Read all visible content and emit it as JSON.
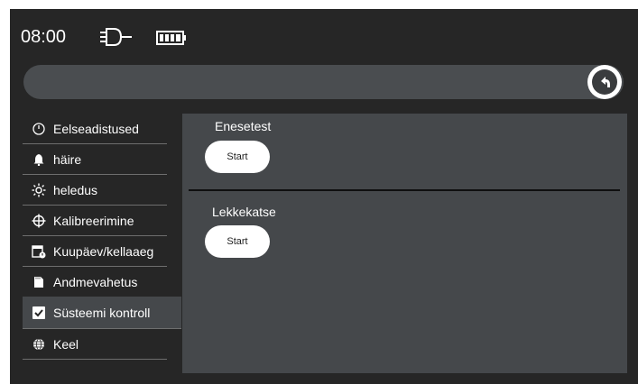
{
  "status": {
    "time": "08:00",
    "plug_icon": "power-plug-icon",
    "battery_icon": "battery-full-icon"
  },
  "header": {
    "back_icon": "back-arrow-icon"
  },
  "sidebar": {
    "items": [
      {
        "label": "Eelseadistused",
        "icon": "gauge-icon",
        "active": false
      },
      {
        "label": "häire",
        "icon": "bell-icon",
        "active": false
      },
      {
        "label": "heledus",
        "icon": "brightness-icon",
        "active": false
      },
      {
        "label": "Kalibreerimine",
        "icon": "crosshair-icon",
        "active": false
      },
      {
        "label": "Kuupäev/kellaaeg",
        "icon": "calendar-clock-icon",
        "active": false
      },
      {
        "label": "Andmevahetus",
        "icon": "sd-card-icon",
        "active": false
      },
      {
        "label": "Süsteemi kontroll",
        "icon": "checkbox-icon",
        "active": true
      },
      {
        "label": "Keel",
        "icon": "globe-icon",
        "active": false
      }
    ]
  },
  "main": {
    "sections": [
      {
        "label": "Enesetest",
        "button_label": "Start"
      },
      {
        "label": "Lekkekatse",
        "button_label": "Start"
      }
    ]
  },
  "colors": {
    "background": "#262626",
    "panel": "#45484b",
    "titlebar": "#4a4d50",
    "text": "#ffffff"
  }
}
